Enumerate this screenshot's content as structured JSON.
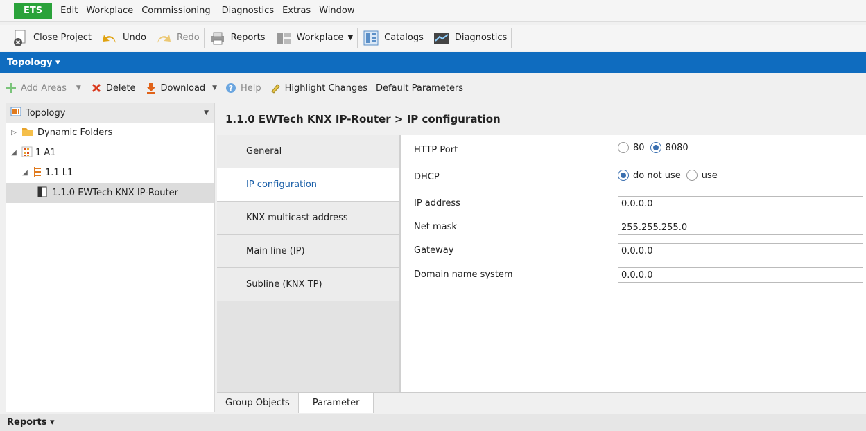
{
  "menubar": {
    "app_button": "ETS",
    "items": [
      "Edit",
      "Workplace",
      "Commissioning",
      "Diagnostics",
      "Extras",
      "Window"
    ]
  },
  "toolbar": {
    "close_project": "Close Project",
    "undo": "Undo",
    "redo": "Redo",
    "reports": "Reports",
    "workplace": "Workplace",
    "catalogs": "Catalogs",
    "diagnostics": "Diagnostics"
  },
  "panel_bar": {
    "title": "Topology ▾"
  },
  "actions": {
    "add_areas": "Add Areas",
    "delete": "Delete",
    "download": "Download",
    "help": "Help",
    "highlight_changes": "Highlight Changes",
    "default_parameters": "Default Parameters"
  },
  "tree": {
    "header": "Topology",
    "items": [
      {
        "label": "Dynamic Folders"
      },
      {
        "label": "1 A1"
      },
      {
        "label": "1.1 L1"
      },
      {
        "label": "1.1.0 EWTech KNX IP-Router"
      }
    ]
  },
  "content": {
    "title": "1.1.0 EWTech KNX IP-Router > IP configuration",
    "tabs": [
      "General",
      "IP configuration",
      "KNX multicast address",
      "Main line (IP)",
      "Subline (KNX TP)"
    ],
    "params": {
      "http_port": {
        "label": "HTTP Port",
        "options": [
          "80",
          "8080"
        ],
        "selected": "8080"
      },
      "dhcp": {
        "label": "DHCP",
        "options": [
          "do not use",
          "use"
        ],
        "selected": "do not use"
      },
      "ip_address": {
        "label": "IP address",
        "value": "0.0.0.0"
      },
      "net_mask": {
        "label": "Net mask",
        "value": "255.255.255.0"
      },
      "gateway": {
        "label": "Gateway",
        "value": "0.0.0.0"
      },
      "dns": {
        "label": "Domain name system",
        "value": "0.0.0.0"
      }
    }
  },
  "bottom_tabs": {
    "group_objects": "Group Objects",
    "parameter": "Parameter"
  },
  "reports_bar": {
    "title": "Reports ▾"
  },
  "colors": {
    "accent_blue": "#0f6cbf",
    "ets_green": "#2aa23a"
  }
}
